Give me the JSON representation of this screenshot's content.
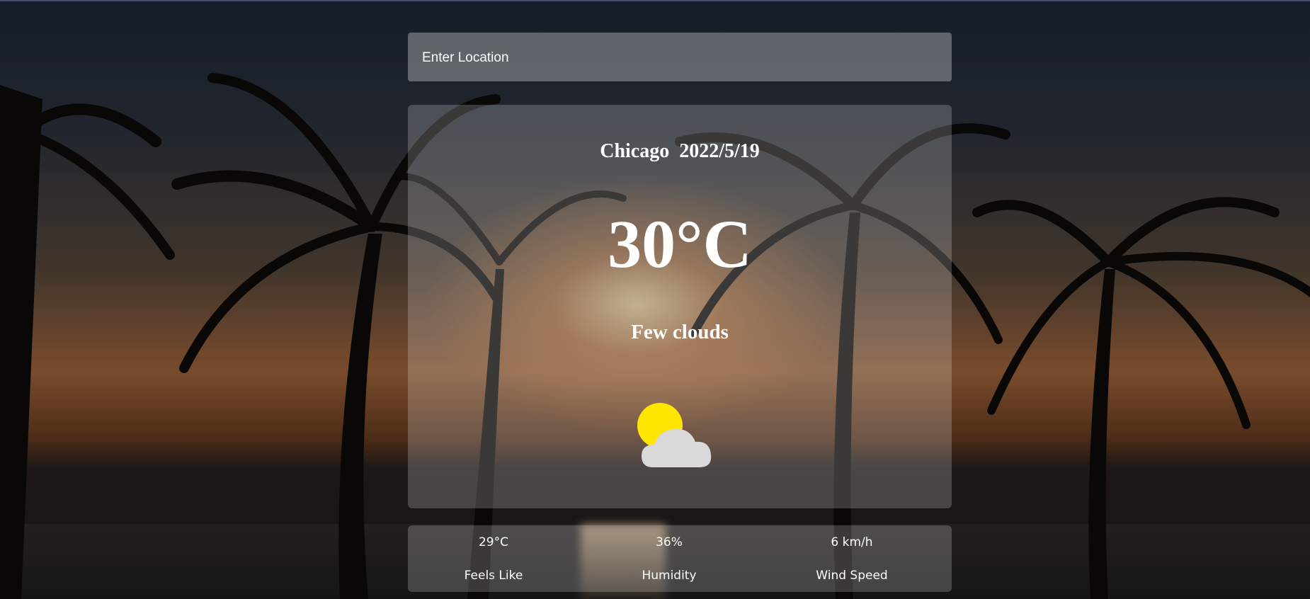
{
  "search": {
    "placeholder": "Enter Location"
  },
  "current": {
    "location_date": "Chicago  2022/5/19",
    "temperature": "30°C",
    "description": "Few clouds",
    "icon": "sun-behind-cloud-icon"
  },
  "stats": [
    {
      "value": "29°C",
      "label": "Feels Like"
    },
    {
      "value": "36%",
      "label": "Humidity"
    },
    {
      "value": "6 km/h",
      "label": "Wind Speed"
    }
  ],
  "colors": {
    "sun": "#ffe600",
    "cloud": "#d9d9d9"
  }
}
